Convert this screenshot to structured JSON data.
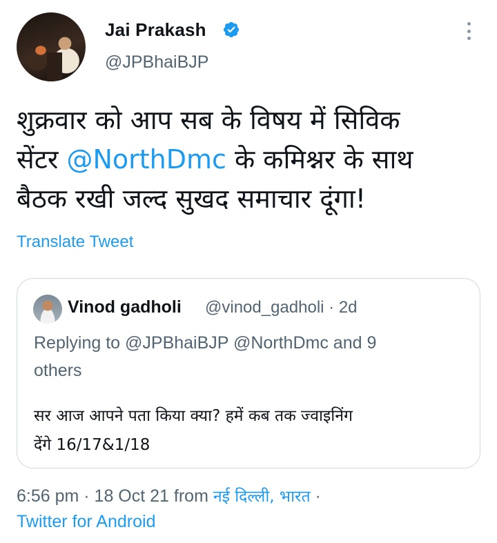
{
  "author": {
    "name": "Jai Prakash",
    "handle": "@JPBhaiBJP",
    "verified": true
  },
  "tweet": {
    "text_lines": [
      {
        "before": "शुक्रवार को आप सब के विषय में सिविक",
        "mention": "",
        "after": ""
      },
      {
        "before": "सेंटर ",
        "mention": "@NorthDmc",
        "after": " के कमिश्नर के साथ"
      },
      {
        "before": "बैठक रखी जल्द सुखद समाचार दूंगा!",
        "mention": "",
        "after": ""
      }
    ],
    "translate_label": "Translate Tweet"
  },
  "quote": {
    "name": "Vinod gadholi",
    "handle": "@vinod_gadholi · 2d",
    "reply_line1": "Replying to @JPBhaiBJP @NorthDmc and 9",
    "reply_line2": "others",
    "text_line1": "सर आज आपने पता किया क्या? हमें कब तक ज्वाइनिंग",
    "text_line2": "देंगे 16/17&1/18"
  },
  "meta": {
    "time_date": "6:56 pm · 18 Oct 21 from ",
    "place": "नई दिल्ली, भारत",
    "separator": " ·",
    "source": "Twitter for Android"
  },
  "colors": {
    "accent": "#1d9bf0",
    "secondary_text": "#536471",
    "primary_text": "#0f1419",
    "border": "#cfd9de"
  },
  "icons": [
    "verified-badge-icon",
    "more-options-icon"
  ]
}
